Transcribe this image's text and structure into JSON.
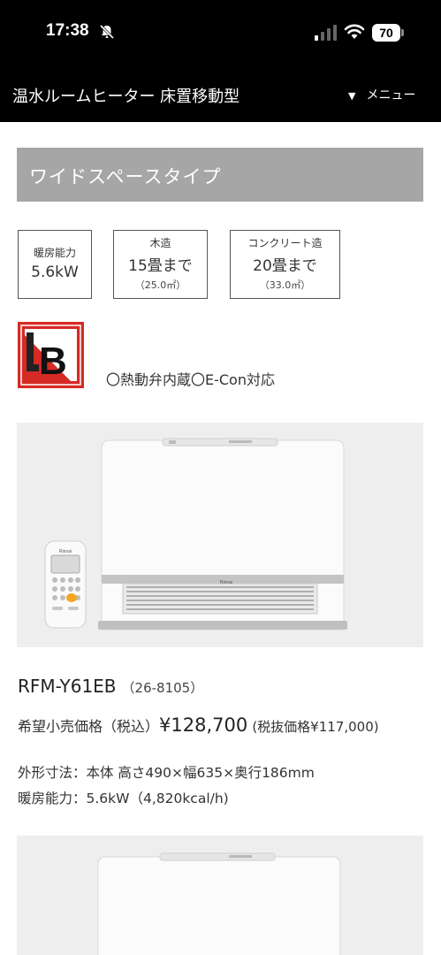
{
  "status": {
    "time": "17:38",
    "battery": "70"
  },
  "header": {
    "title": "温水ルームヒーター 床置移動型",
    "menu_label": "メニュー",
    "menu_arrow": "▼"
  },
  "section": {
    "title": "ワイドスペースタイプ"
  },
  "specs": [
    {
      "label": "暖房能力",
      "value": "5.6kW",
      "note": ""
    },
    {
      "label": "木造",
      "value": "15畳まで",
      "note": "（25.0㎡）"
    },
    {
      "label": "コンクリート造",
      "value": "20畳まで",
      "note": "（33.0㎡）"
    }
  ],
  "features": "〇熱動弁内蔵〇E-Con対応",
  "product": {
    "model": "RFM-Y61EB",
    "code": "（26-8105）",
    "price_label": "希望小売価格（税込）",
    "price": "¥128,700",
    "price_excl": "(税抜価格¥117,000)",
    "dimensions": "外形寸法：本体 高さ490×幅635×奥行186mm",
    "heating": "暖房能力：5.6kW（4,820kcal/h)"
  },
  "brand": {
    "badge_letter": "B",
    "remote_brand": "Rinnai",
    "heater_brand": "Rinnai"
  },
  "colors": {
    "header_bg": "#000000",
    "band_bg": "#a6a6a6",
    "badge_red": "#d62a25"
  }
}
